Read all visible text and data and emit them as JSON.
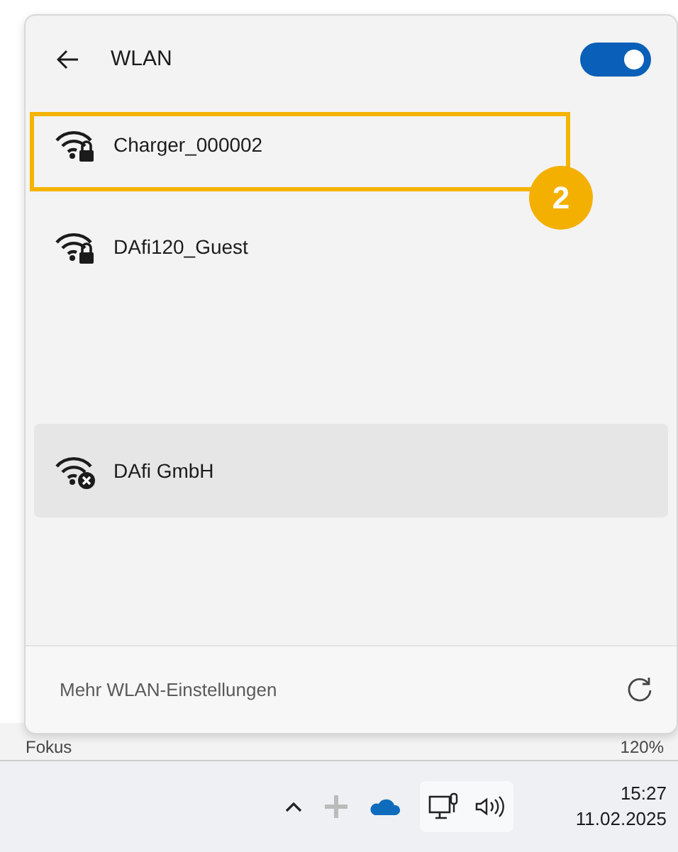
{
  "flyout": {
    "title": "WLAN",
    "wifi_on": true,
    "networks": [
      {
        "name": "Charger_000002",
        "kind": "secured",
        "highlighted": false
      },
      {
        "name": "DAfi120_Guest",
        "kind": "secured",
        "highlighted": false
      },
      {
        "name": "DAfi GmbH",
        "kind": "disconnected",
        "highlighted": true
      }
    ],
    "footer_link": "Mehr WLAN-Einstellungen"
  },
  "callout": {
    "badge": "2"
  },
  "word_status_bar": {
    "focus_label": "Fokus",
    "zoom": "120%"
  },
  "taskbar": {
    "time": "15:27",
    "date": "11.02.2025"
  }
}
